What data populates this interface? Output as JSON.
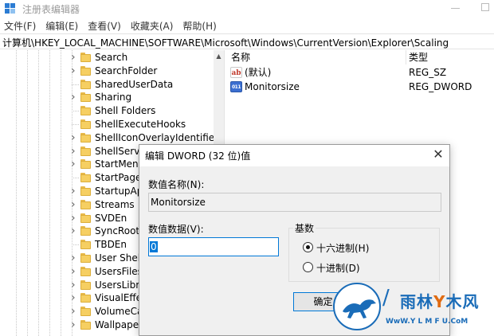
{
  "window": {
    "title": "注册表编辑器"
  },
  "menubar": {
    "items": [
      "文件(F)",
      "编辑(E)",
      "查看(V)",
      "收藏夹(A)",
      "帮助(H)"
    ]
  },
  "address": {
    "path": "计算机\\HKEY_LOCAL_MACHINE\\SOFTWARE\\Microsoft\\Windows\\CurrentVersion\\Explorer\\Scaling"
  },
  "tree": {
    "items": [
      {
        "label": "Search",
        "expandable": true
      },
      {
        "label": "SearchFolder",
        "expandable": true
      },
      {
        "label": "SharedUserData",
        "expandable": false
      },
      {
        "label": "Sharing",
        "expandable": true
      },
      {
        "label": "Shell Folders",
        "expandable": false
      },
      {
        "label": "ShellExecuteHooks",
        "expandable": false
      },
      {
        "label": "ShellIconOverlayIdentifier",
        "expandable": true
      },
      {
        "label": "ShellServi",
        "expandable": true
      },
      {
        "label": "StartMenu",
        "expandable": true
      },
      {
        "label": "StartPage",
        "expandable": false
      },
      {
        "label": "StartupAp",
        "expandable": true
      },
      {
        "label": "Streams",
        "expandable": true
      },
      {
        "label": "SVDEn",
        "expandable": true
      },
      {
        "label": "SyncRoot",
        "expandable": true
      },
      {
        "label": "TBDEn",
        "expandable": false
      },
      {
        "label": "User Shell",
        "expandable": true
      },
      {
        "label": "UsersFiles",
        "expandable": true
      },
      {
        "label": "UsersLibra",
        "expandable": true
      },
      {
        "label": "VisualEffe",
        "expandable": true
      },
      {
        "label": "VolumeCa",
        "expandable": true
      },
      {
        "label": "Wallpapers",
        "expandable": true
      }
    ]
  },
  "list": {
    "columns": {
      "name": "名称",
      "type": "类型"
    },
    "rows": [
      {
        "icon": "string-value-icon",
        "name": "(默认)",
        "type": "REG_SZ"
      },
      {
        "icon": "dword-value-icon",
        "name": "Monitorsize",
        "type": "REG_DWORD"
      }
    ]
  },
  "dialog": {
    "title": "编辑 DWORD (32 位)值",
    "name_label": "数值名称(N):",
    "name_value": "Monitorsize",
    "data_label": "数值数据(V):",
    "data_value": "0",
    "base_label": "基数",
    "radio_hex": "十六进制(H)",
    "radio_dec": "十进制(D)",
    "selected_base": "hex",
    "ok_label": "确定"
  },
  "watermark": {
    "brand_a": "雨林",
    "brand_b": "木风",
    "url": "WwW.Y L M F U.CoM"
  },
  "colors": {
    "accent": "#0078d7",
    "folder": "#f6cf62",
    "watermark_blue": "#1a6cb8"
  }
}
